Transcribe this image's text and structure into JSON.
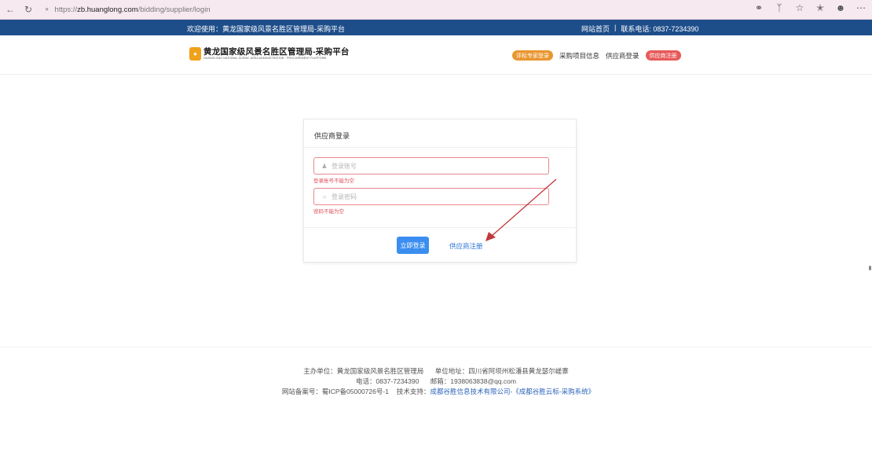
{
  "browser": {
    "url_scheme": "https://",
    "url_host": "zb.huanglong.com",
    "url_path": "/bidding/supplier/login"
  },
  "topstrip": {
    "welcome": "欢迎使用：黄龙国家级风景名胜区管理局-采购平台",
    "home": "网站首页",
    "sep": "|",
    "phone": "联系电话: 0837-7234390"
  },
  "header": {
    "logo_title": "黄龙国家级风景名胜区管理局-采购平台",
    "logo_sub": "HUANGLONG NATIONAL SCENIC AREA ADMINISTRATION · PROCUREMENT PLATFORM",
    "menu": {
      "expert_login": "评标专家登录",
      "project_info": "采购项目信息",
      "supplier_login": "供应商登录",
      "supplier_register": "供应商注册"
    }
  },
  "login": {
    "title": "供应商登录",
    "account_placeholder": "登录账号",
    "account_error": "登录账号不能为空",
    "password_placeholder": "登录密码",
    "password_error": "密码不能为空",
    "submit": "立即登录",
    "register": "供应商注册"
  },
  "footer": {
    "host": "主办单位：黄龙国家级风景名胜区管理局",
    "address": "单位地址：四川省阿坝州松潘县黄龙瑟尔嵯寨",
    "phone": "电话：0837-7234390",
    "email": "邮箱：1938063838@qq.com",
    "icp": "网站备案号：蜀ICP备05000726号-1",
    "support_label": "技术支持：",
    "support_company": "成都谷胜信息技术有限公司-《成都谷胜云标-采购系统》"
  },
  "colors": {
    "topstrip": "#1e4e8a",
    "primary_button": "#3b8ef0",
    "error": "#e2505a",
    "arrow": "#c0393b"
  }
}
